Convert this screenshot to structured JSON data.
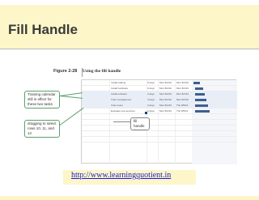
{
  "slide": {
    "title": "Fill Handle",
    "url": "http://www.learningquotient.in"
  },
  "figure": {
    "label": "Figure 2-28",
    "title": "Using the fill handle"
  },
  "callouts": {
    "training_calendar": "Training calendar still in effect for these two tasks",
    "dragging": "dragging to select rows 10, 11, and 12",
    "fill_handle": "fill handle"
  },
  "sheet": {
    "rows": [
      {
        "name": "Install cabling",
        "dur": "5 days",
        "start": "Mon 8/2/10",
        "finish": "Mon 8/2/10",
        "bar": 8
      },
      {
        "name": "Install hardware",
        "dur": "2 days",
        "start": "Mon 8/2/10",
        "finish": "Mon 8/2/10",
        "bar": 10
      },
      {
        "name": "Install software",
        "dur": "3 days",
        "start": "Mon 8/2/10",
        "finish": "Mon 8/2/10",
        "bar": 12
      },
      {
        "name": "Train management",
        "dur": "3 days",
        "start": "Mon 8/2/10",
        "finish": "Mon 8/2/10",
        "bar": 14
      },
      {
        "name": "Train users",
        "dur": "3 days",
        "start": "Mon 8/2/10",
        "finish": "Thu 8/5/10",
        "bar": 16
      },
      {
        "name": "Evaluate new services",
        "dur": "3 days",
        "start": "Mon 8/2/10",
        "finish": "Thu 8/5/10",
        "bar": 18
      }
    ]
  }
}
